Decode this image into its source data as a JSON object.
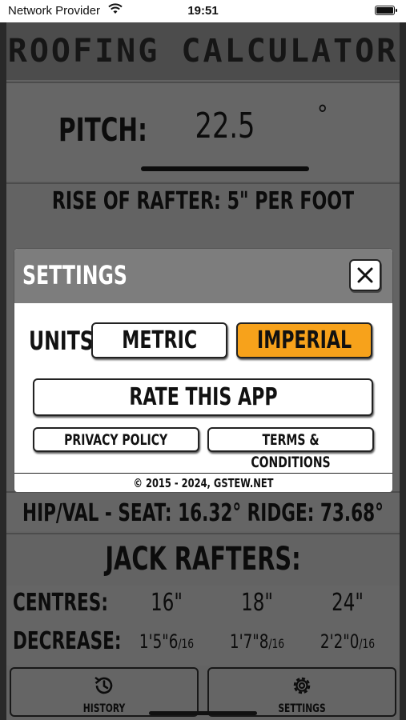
{
  "status_bar": {
    "carrier": "Network Provider",
    "time": "19:51",
    "wifi_icon": "wifi-icon",
    "battery_icon": "battery-icon"
  },
  "app": {
    "title": "ROOFING CALCULATOR",
    "pitch": {
      "label": "PITCH:",
      "value": "22.5",
      "unit": "°"
    },
    "rise": "RISE OF RAFTER: 5\" PER FOOT",
    "hip_val": "HIP/VAL - SEAT: 16.32° RIDGE: 73.68°",
    "jack_rafters": {
      "title": "JACK RAFTERS:",
      "centres_label": "CENTRES:",
      "centres": [
        "16\"",
        "18\"",
        "24\""
      ],
      "decrease_label": "DECREASE:",
      "decrease": [
        {
          "main": "1'5\"6",
          "frac": "/16"
        },
        {
          "main": "1'7\"8",
          "frac": "/16"
        },
        {
          "main": "2'2\"0",
          "frac": "/16"
        }
      ]
    },
    "tabs": [
      {
        "label": "HISTORY",
        "icon": "history-icon"
      },
      {
        "label": "SETTINGS",
        "icon": "gear-icon"
      }
    ]
  },
  "settings_modal": {
    "title": "SETTINGS",
    "close_icon": "close-icon",
    "units_label": "UNITS:",
    "units_options": [
      "METRIC",
      "IMPERIAL"
    ],
    "selected_unit": "IMPERIAL",
    "rate_label": "RATE THIS APP",
    "privacy_label": "PRIVACY POLICY",
    "terms_label": "TERMS & CONDITIONS",
    "copyright": "© 2015 - 2024, GSTEW.NET"
  },
  "colors": {
    "selected_accent": "#f7a21b",
    "modal_header": "#7d7d7d"
  }
}
